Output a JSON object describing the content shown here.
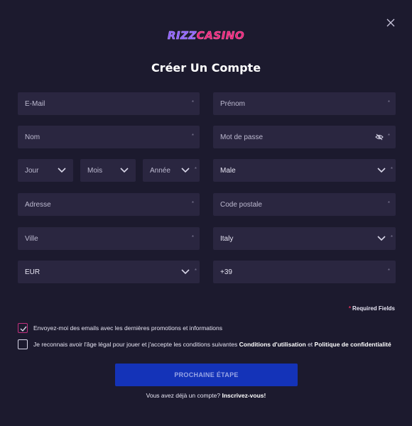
{
  "brand": {
    "logo_part1": "RIZZ",
    "logo_part2": "CASINO",
    "accent_purple": "#8a5cff",
    "accent_pink": "#e8257a"
  },
  "close_icon": "close-icon",
  "form": {
    "title": "Créer Un Compte",
    "required_marker": "*",
    "fields": {
      "email": {
        "placeholder": "E-Mail"
      },
      "prenom": {
        "placeholder": "Prénom"
      },
      "nom": {
        "placeholder": "Nom"
      },
      "password": {
        "placeholder": "Mot de passe",
        "icon": "eye-slash-icon"
      },
      "jour": {
        "label": "Jour"
      },
      "mois": {
        "label": "Mois"
      },
      "annee": {
        "label": "Année"
      },
      "gender": {
        "value": "Male"
      },
      "adresse": {
        "placeholder": "Adresse"
      },
      "code_postal": {
        "placeholder": "Code postale"
      },
      "ville": {
        "placeholder": "Ville"
      },
      "country": {
        "value": "Italy"
      },
      "currency": {
        "value": "EUR"
      },
      "phone": {
        "value": "+39"
      }
    },
    "required_note": "Required Fields",
    "checkbox_promo": {
      "label": "Envoyez-moi des emails avec les dernières promotions et informations",
      "checked": true
    },
    "checkbox_terms": {
      "label_prefix": "Je reconnais avoir l'âge légal pour jouer et j'accepte les conditions suivantes",
      "link_terms": "Conditions d'utilisation",
      "joiner": "et",
      "link_privacy": "Politique de confidentialité",
      "checked": false
    },
    "submit_label": "PROCHAINE ÉTAPE",
    "signin_prefix": "Vous avez déjà un compte?",
    "signin_link": "Inscrivez-vous!"
  },
  "colors": {
    "background": "#1c1a2e",
    "field_bg": "#2a2640",
    "button_bg": "#1433b8",
    "check_accent": "#c2307e",
    "required_star": "#e0305a"
  }
}
